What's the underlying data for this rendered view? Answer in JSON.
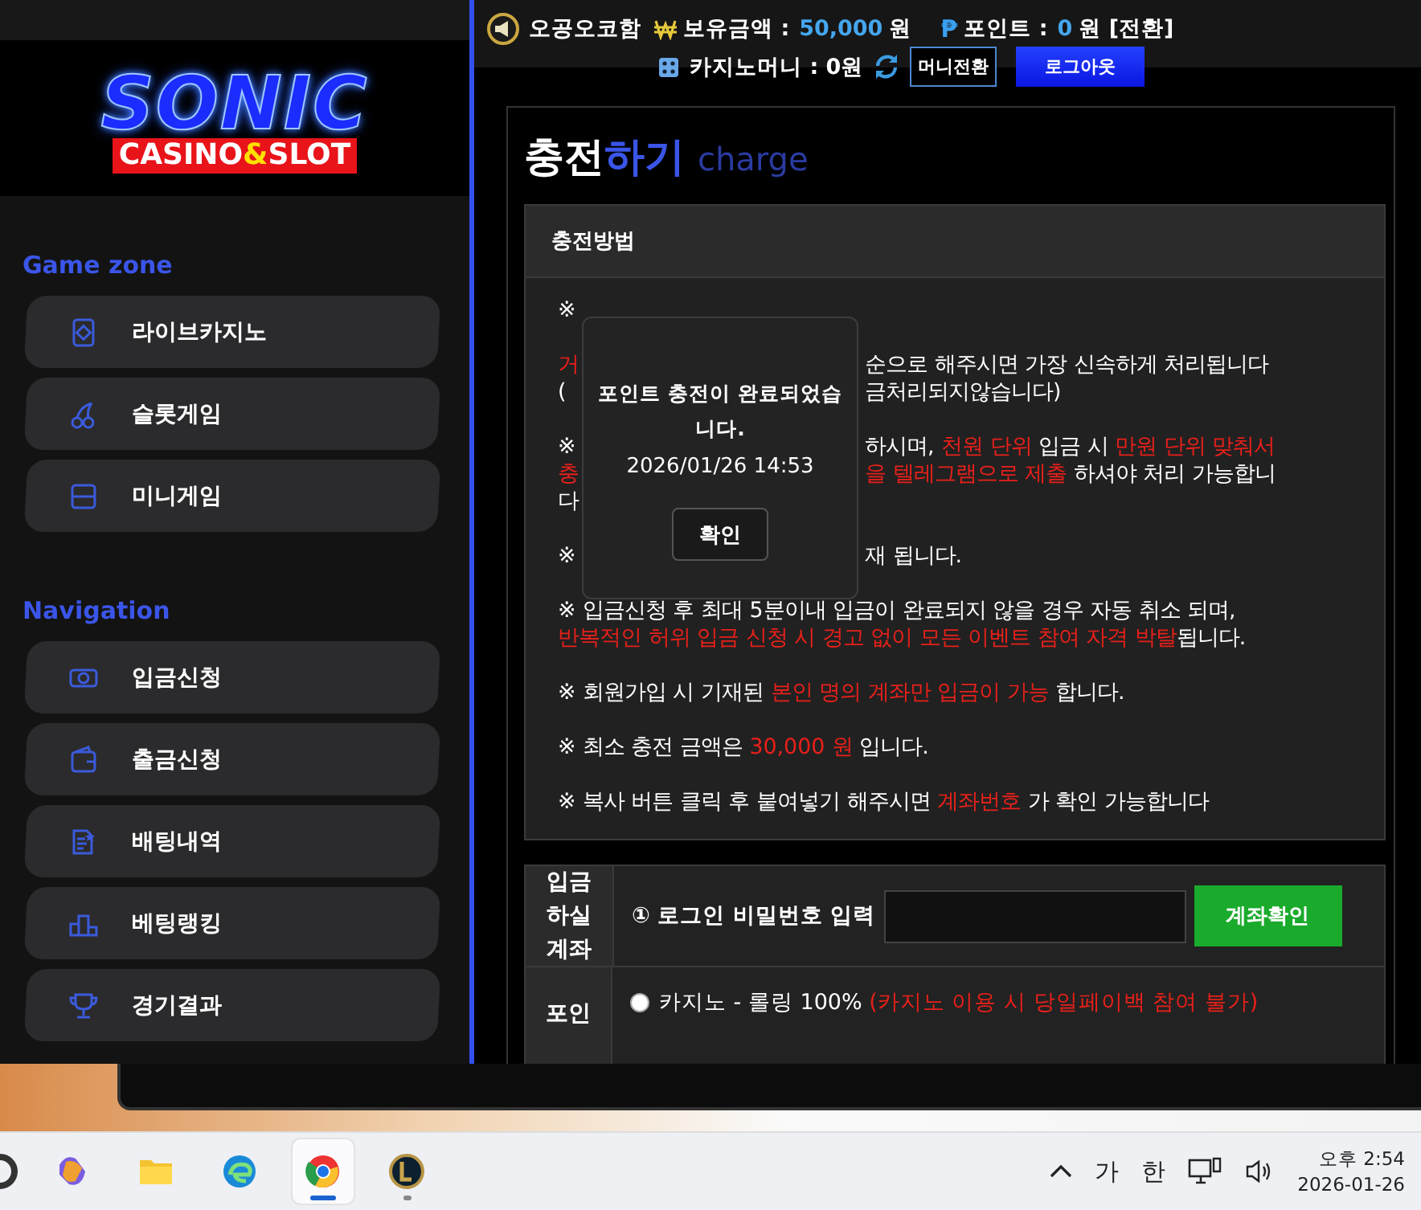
{
  "header": {
    "ticker": "오공오코함",
    "balance_label": "보유금액 :",
    "balance_value": "50,000",
    "balance_unit": "원",
    "point_symbol": "₱",
    "point_label": "포인트 :",
    "point_value": "0",
    "point_unit": "원 [전환]",
    "casino_label": "카지노머니 : 0원",
    "convert_button": "머니전환",
    "logout_button": "로그아웃"
  },
  "logo": {
    "title": "SONIC",
    "badge": [
      {
        "text": "CASINO",
        "accent": false
      },
      {
        "text": "&",
        "accent": true
      },
      {
        "text": "SLOT",
        "accent": false
      }
    ]
  },
  "sidebar": {
    "sections": [
      {
        "heading": "Game zone",
        "items": [
          {
            "label": "라이브카지노"
          },
          {
            "label": "슬롯게임"
          },
          {
            "label": "미니게임"
          }
        ]
      },
      {
        "heading": "Navigation",
        "items": [
          {
            "label": "입금신청"
          },
          {
            "label": "출금신청"
          },
          {
            "label": "배팅내역"
          },
          {
            "label": "베팅랭킹"
          },
          {
            "label": "경기결과"
          }
        ]
      }
    ]
  },
  "page": {
    "title_main": "충전",
    "title_accent": "하기",
    "title_sub": "charge"
  },
  "notice": {
    "heading": "충전방법",
    "paragraphs": [
      [
        {
          "left": [
            {
              "text": "※",
              "emphasis": false
            }
          ]
        }
      ],
      [
        {
          "left": [
            {
              "text": "거",
              "emphasis": true
            }
          ],
          "right": [
            {
              "text": "순으로 해주시면 가장 신속하게 처리됩니다",
              "emphasis": false
            }
          ]
        },
        {
          "left": [
            {
              "text": "(",
              "emphasis": false
            }
          ],
          "right": [
            {
              "text": "금처리되지않습니다)",
              "emphasis": false
            }
          ]
        }
      ],
      [
        {
          "left": [
            {
              "text": "※",
              "emphasis": false
            }
          ],
          "right": [
            {
              "text": "하시며, ",
              "emphasis": false
            },
            {
              "text": "천원 단위",
              "emphasis": true
            },
            {
              "text": " 입금 시 ",
              "emphasis": false
            },
            {
              "text": "만원 단위 맞춰서",
              "emphasis": true
            }
          ]
        },
        {
          "left": [
            {
              "text": "충",
              "emphasis": true
            }
          ],
          "right": [
            {
              "text": "을 텔레그램으로 제출",
              "emphasis": true
            },
            {
              "text": " 하셔야 처리 가능합니",
              "emphasis": false
            }
          ]
        },
        {
          "left": [
            {
              "text": "다",
              "emphasis": false
            }
          ]
        }
      ],
      [
        {
          "left": [
            {
              "text": "※",
              "emphasis": false
            }
          ],
          "right": [
            {
              "text": "재 됩니다.",
              "emphasis": false
            }
          ]
        }
      ],
      [
        {
          "full": [
            {
              "text": "※ 입금신청 후 최대 5분이내 입금이 완료되지 않을 경우 자동 취소 되며,",
              "emphasis": false
            }
          ]
        },
        {
          "full": [
            {
              "text": "반복적인 허위 입금 신청 시 경고 없이 모든 이벤트 참여 자격 박탈",
              "emphasis": true
            },
            {
              "text": "됩니다.",
              "emphasis": false
            }
          ]
        }
      ],
      [
        {
          "full": [
            {
              "text": "※ 회원가입 시 기재된 ",
              "emphasis": false
            },
            {
              "text": "본인 명의 계좌만 입금이 가능",
              "emphasis": true
            },
            {
              "text": " 합니다.",
              "emphasis": false
            }
          ]
        }
      ],
      [
        {
          "full": [
            {
              "text": "※ 최소 충전 금액은 ",
              "emphasis": false
            },
            {
              "text": "30,000 원",
              "emphasis": true
            },
            {
              "text": " 입니다.",
              "emphasis": false
            }
          ]
        }
      ],
      [
        {
          "full": [
            {
              "text": "※ 복사 버튼 클릭 후 붙여넣기 해주시면 ",
              "emphasis": false
            },
            {
              "text": "계좌번호",
              "emphasis": true
            },
            {
              "text": " 가 확인 가능합니다",
              "emphasis": false
            }
          ]
        }
      ]
    ]
  },
  "dialog": {
    "message": "포인트 충전이 완료되었습니다.",
    "time": "2026/01/26 14:53",
    "button": "확인"
  },
  "form": {
    "account_label": "입금하실계좌",
    "password_label": "① 로그인 비밀번호 입력",
    "check_button": "계좌확인",
    "point_label": "포인",
    "options": [
      {
        "label": "카지노 - 롤링 100% ",
        "note": "(카지노 이용 시 당일페이백 참여 불가)",
        "selected": false
      }
    ]
  },
  "taskbar": {
    "apps": [
      {
        "selected": false,
        "running": false
      },
      {
        "selected": false,
        "running": false
      },
      {
        "selected": false,
        "running": false
      },
      {
        "selected": true,
        "running": true
      },
      {
        "selected": false,
        "running": true
      }
    ],
    "ime_mode": "가",
    "ime_lang": "한",
    "time": "오후 2:54",
    "date": "2026-01-26"
  }
}
